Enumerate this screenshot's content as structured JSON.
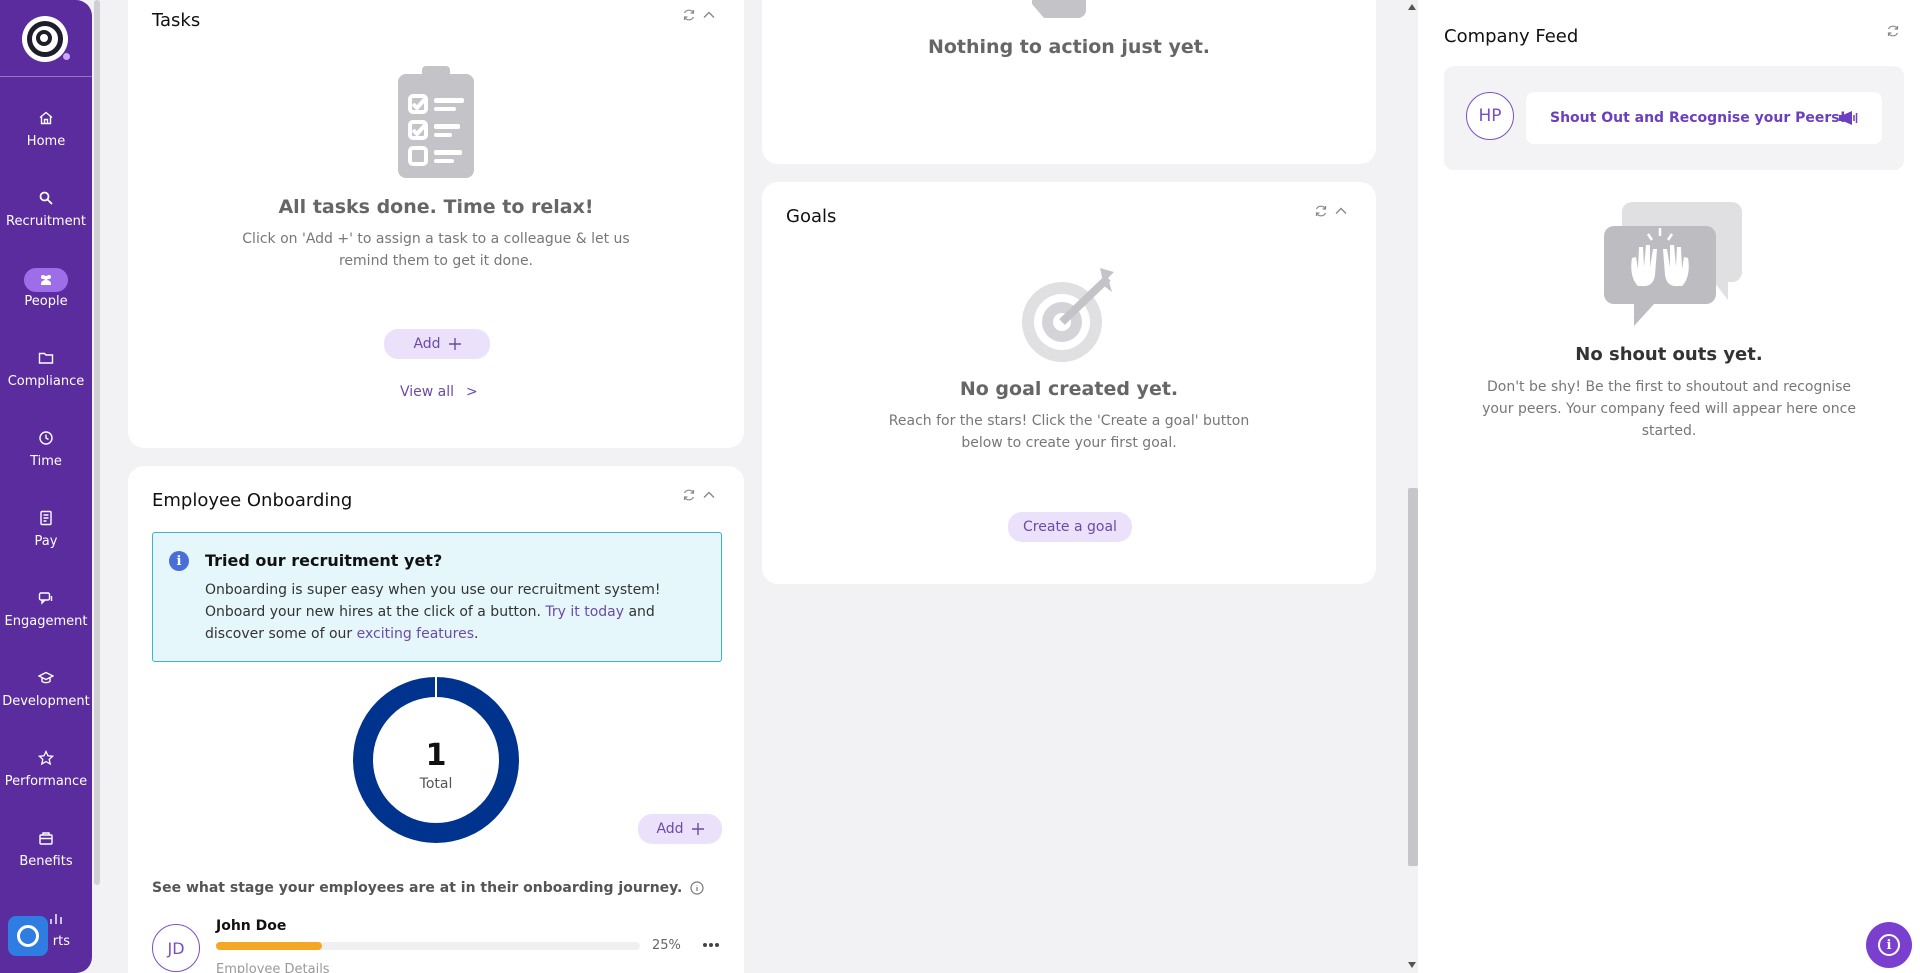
{
  "sidebar": {
    "items": [
      {
        "label": "Home",
        "icon": "home-icon"
      },
      {
        "label": "Recruitment",
        "icon": "search-icon"
      },
      {
        "label": "People",
        "icon": "people-icon"
      },
      {
        "label": "Compliance",
        "icon": "folder-icon"
      },
      {
        "label": "Time",
        "icon": "time-icon"
      },
      {
        "label": "Pay",
        "icon": "pay-icon"
      },
      {
        "label": "Engagement",
        "icon": "chat-icon"
      },
      {
        "label": "Development",
        "icon": "graduation-cap-icon"
      },
      {
        "label": "Performance",
        "icon": "star-icon"
      },
      {
        "label": "Benefits",
        "icon": "gift-icon"
      },
      {
        "label": "rts",
        "icon": "reports-icon"
      }
    ],
    "active": "People"
  },
  "tasks": {
    "title": "Tasks",
    "empty_title": "All tasks done. Time to relax!",
    "empty_text_1": "Click on 'Add +' to assign a task to a colleague & let us",
    "empty_text_2": "remind them to get it done.",
    "add_label": "Add",
    "view_all_label": "View all",
    "view_all_chevron": ">"
  },
  "actions": {
    "empty_title": "Nothing to action just yet."
  },
  "goals": {
    "title": "Goals",
    "empty_title": "No goal created yet.",
    "empty_text_1": "Reach for the stars! Click the 'Create a goal' button",
    "empty_text_2": "below to create your first goal.",
    "create_label": "Create a goal"
  },
  "onboarding": {
    "title": "Employee Onboarding",
    "info_title": "Tried our recruitment yet?",
    "info_text_1": "Onboarding is super easy when you use our recruitment system! Onboard your new hires at the click of a button. ",
    "info_link_1": "Try it today",
    "info_text_2": " and discover some of our ",
    "info_link_2": "exciting features",
    "info_text_3": ".",
    "donut_value": "1",
    "donut_label": "Total",
    "add_label": "Add",
    "stage_text": "See what stage your employees are at in their onboarding journey.",
    "employees": [
      {
        "initials": "JD",
        "name": "John Doe",
        "progress": 25,
        "progress_label": "25%",
        "sub": "Employee Details"
      }
    ],
    "progress_color": "#f5a623",
    "donut_color": "#00338d"
  },
  "feed": {
    "title": "Company Feed",
    "avatar_initials": "HP",
    "shout_label": "Shout Out and Recognise your Peers!",
    "empty_title": "No shout outs yet.",
    "empty_text_1": "Don't be shy! Be the first to shoutout and recognise",
    "empty_text_2": "your peers. Your company feed will appear here once",
    "empty_text_3": "started."
  },
  "colors": {
    "sidebar": "#5b2c9e",
    "accent": "#7b3fd0",
    "pill": "#ece1fb"
  }
}
